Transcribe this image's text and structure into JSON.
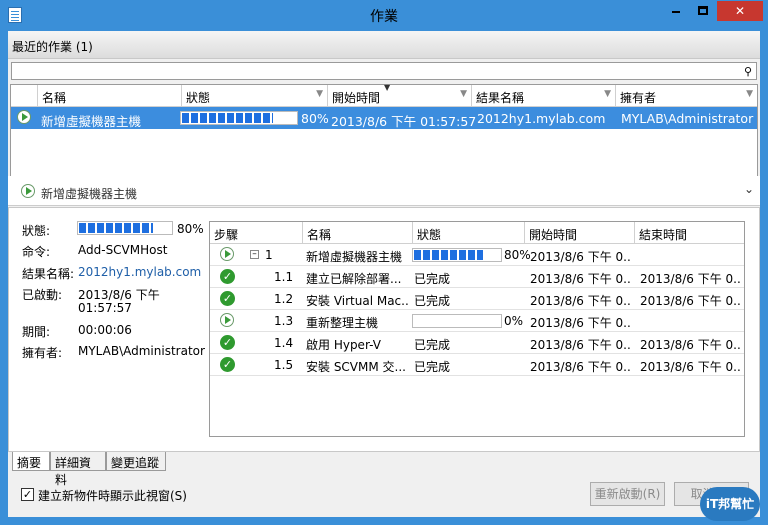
{
  "window": {
    "title": "作業",
    "min_label": "—",
    "max_label": "",
    "close_label": "✕"
  },
  "recent": {
    "heading": "最近的作業 (1)",
    "search_placeholder": ""
  },
  "jobs_grid": {
    "columns": [
      "名稱",
      "狀態",
      "開始時間",
      "結果名稱",
      "擁有者"
    ],
    "rows": [
      {
        "name": "新增虛擬機器主機",
        "progress_pct": 80,
        "progress_label": "80%",
        "start": "2013/8/6 下午 01:57:57",
        "result": "2012hy1.mylab.com",
        "owner": "MYLAB\\Administrator"
      }
    ]
  },
  "detail": {
    "header": "新增虛擬機器主機",
    "summary": {
      "status_label": "狀態:",
      "status_pct": 80,
      "status_value": "80%",
      "command_label": "命令:",
      "command_value": "Add-SCVMHost",
      "result_label": "結果名稱:",
      "result_value": "2012hy1.mylab.com",
      "started_label": "已啟動:",
      "started_value_1": "2013/8/6 下午",
      "started_value_2": "01:57:57",
      "duration_label": "期間:",
      "duration_value": "00:00:06",
      "owner_label": "擁有者:",
      "owner_value": "MYLAB\\Administrator"
    },
    "steps_columns": [
      "步驟",
      "名稱",
      "狀態",
      "開始時間",
      "結束時間"
    ],
    "steps": [
      {
        "icon": "play",
        "step": "1",
        "name": "新增虛擬機器主機",
        "status": "80%",
        "progress_pct": 80,
        "start": "2013/8/6 下午 0...",
        "end": ""
      },
      {
        "icon": "check",
        "step": "1.1",
        "name": "建立已解除部署...",
        "status": "已完成",
        "start": "2013/8/6 下午 0...",
        "end": "2013/8/6 下午 0..."
      },
      {
        "icon": "check",
        "step": "1.2",
        "name": "安裝 Virtual Mac...",
        "status": "已完成",
        "start": "2013/8/6 下午 0...",
        "end": "2013/8/6 下午 0..."
      },
      {
        "icon": "play",
        "step": "1.3",
        "name": "重新整理主機",
        "status": "0%",
        "progress_pct": 0,
        "start": "2013/8/6 下午 0...",
        "end": ""
      },
      {
        "icon": "check",
        "step": "1.4",
        "name": "啟用 Hyper-V",
        "status": "已完成",
        "start": "2013/8/6 下午 0...",
        "end": "2013/8/6 下午 0..."
      },
      {
        "icon": "check",
        "step": "1.5",
        "name": "安裝 SCVMM 交...",
        "status": "已完成",
        "start": "2013/8/6 下午 0...",
        "end": "2013/8/6 下午 0..."
      }
    ]
  },
  "tabs": [
    "摘要",
    "詳細資料",
    "變更追蹤"
  ],
  "footer": {
    "checkbox_label": "建立新物件時顯示此視窗(S)",
    "checkbox_checked": true,
    "restart_label": "重新啟動(R)",
    "cancel_label": "取消(C)"
  },
  "badge": {
    "text": "iT邦幫忙"
  }
}
